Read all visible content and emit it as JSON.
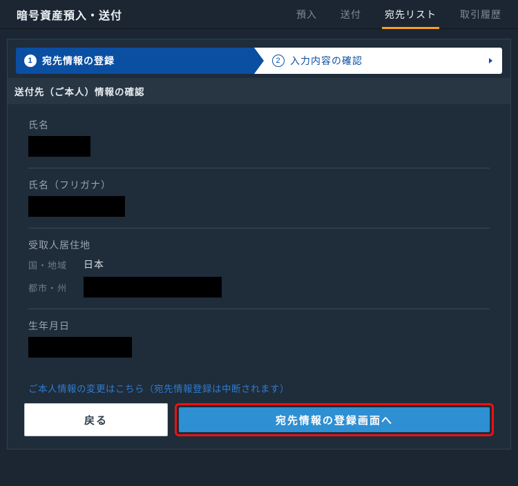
{
  "header": {
    "title": "暗号資産預入・送付",
    "tabs": [
      "預入",
      "送付",
      "宛先リスト",
      "取引履歴"
    ],
    "active_tab": "宛先リスト"
  },
  "stepper": {
    "step1": {
      "num": "1",
      "label": "宛先情報の登録"
    },
    "step2": {
      "num": "2",
      "label": "入力内容の確認"
    }
  },
  "section_title": "送付先（ご本人）情報の確認",
  "fields": {
    "name_label": "氏名",
    "name_kana_label": "氏名（フリガナ）",
    "residence_label": "受取人居住地",
    "country_label": "国・地域",
    "country_value": "日本",
    "city_label": "都市・州",
    "dob_label": "生年月日"
  },
  "note_link": "ご本人情報の変更はこちら（宛先情報登録は中断されます）",
  "buttons": {
    "back": "戻る",
    "submit": "宛先情報の登録画面へ"
  }
}
